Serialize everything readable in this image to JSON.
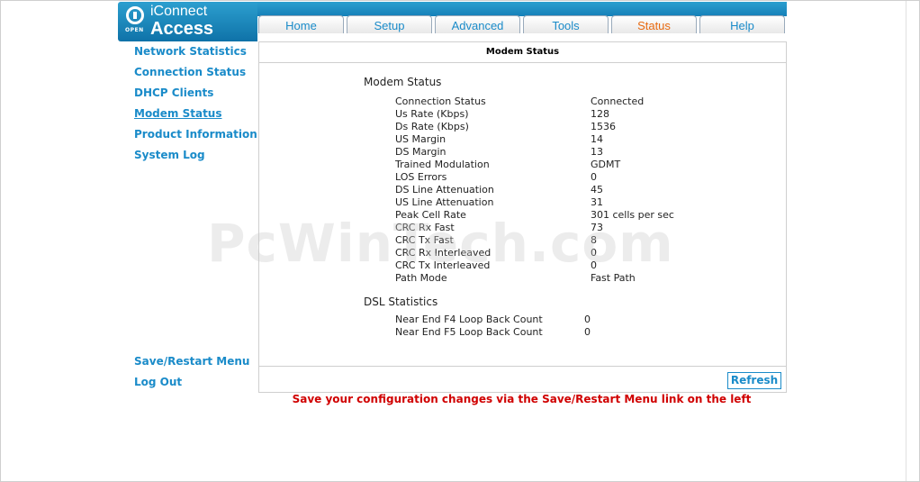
{
  "logo": {
    "badge": "OPEN",
    "title": "iConnect",
    "subtitle": "Access"
  },
  "tabs": [
    {
      "label": "Home",
      "active": false
    },
    {
      "label": "Setup",
      "active": false
    },
    {
      "label": "Advanced",
      "active": false
    },
    {
      "label": "Tools",
      "active": false
    },
    {
      "label": "Status",
      "active": true
    },
    {
      "label": "Help",
      "active": false
    }
  ],
  "sidebar": {
    "items": [
      {
        "label": "Network Statistics"
      },
      {
        "label": "Connection Status"
      },
      {
        "label": "DHCP Clients"
      },
      {
        "label": "Modem Status",
        "current": true
      },
      {
        "label": "Product Information"
      },
      {
        "label": "System Log"
      }
    ],
    "bottom_items": [
      {
        "label": "Save/Restart Menu"
      },
      {
        "label": "Log Out"
      }
    ]
  },
  "panel": {
    "header": "Modem Status",
    "modem_section_title": "Modem Status",
    "modem_rows": [
      {
        "key": "Connection Status",
        "value": "Connected"
      },
      {
        "key": "Us Rate (Kbps)",
        "value": "128"
      },
      {
        "key": "Ds Rate (Kbps)",
        "value": "1536"
      },
      {
        "key": "US Margin",
        "value": "14"
      },
      {
        "key": "DS Margin",
        "value": "13"
      },
      {
        "key": "Trained Modulation",
        "value": "GDMT"
      },
      {
        "key": "LOS Errors",
        "value": "0"
      },
      {
        "key": "DS Line Attenuation",
        "value": "45"
      },
      {
        "key": "US Line Attenuation",
        "value": "31"
      },
      {
        "key": "Peak Cell Rate",
        "value": "301 cells per sec"
      },
      {
        "key": "CRC Rx Fast",
        "value": "73"
      },
      {
        "key": "CRC Tx Fast",
        "value": "8"
      },
      {
        "key": "CRC Rx Interleaved",
        "value": "0"
      },
      {
        "key": "CRC Tx Interleaved",
        "value": "0"
      },
      {
        "key": "Path Mode",
        "value": "Fast Path"
      }
    ],
    "dsl_section_title": "DSL Statistics",
    "dsl_rows": [
      {
        "key": "Near End F4 Loop Back Count",
        "value": "0"
      },
      {
        "key": "Near End F5 Loop Back Count",
        "value": "0"
      }
    ],
    "refresh_label": "Refresh"
  },
  "notice": "Save your configuration changes via the Save/Restart Menu link on the left",
  "watermark": "PcWinTech.com",
  "colors": {
    "accent": "#1a8bc9",
    "active_tab": "#e86a10",
    "notice": "#d00000"
  }
}
